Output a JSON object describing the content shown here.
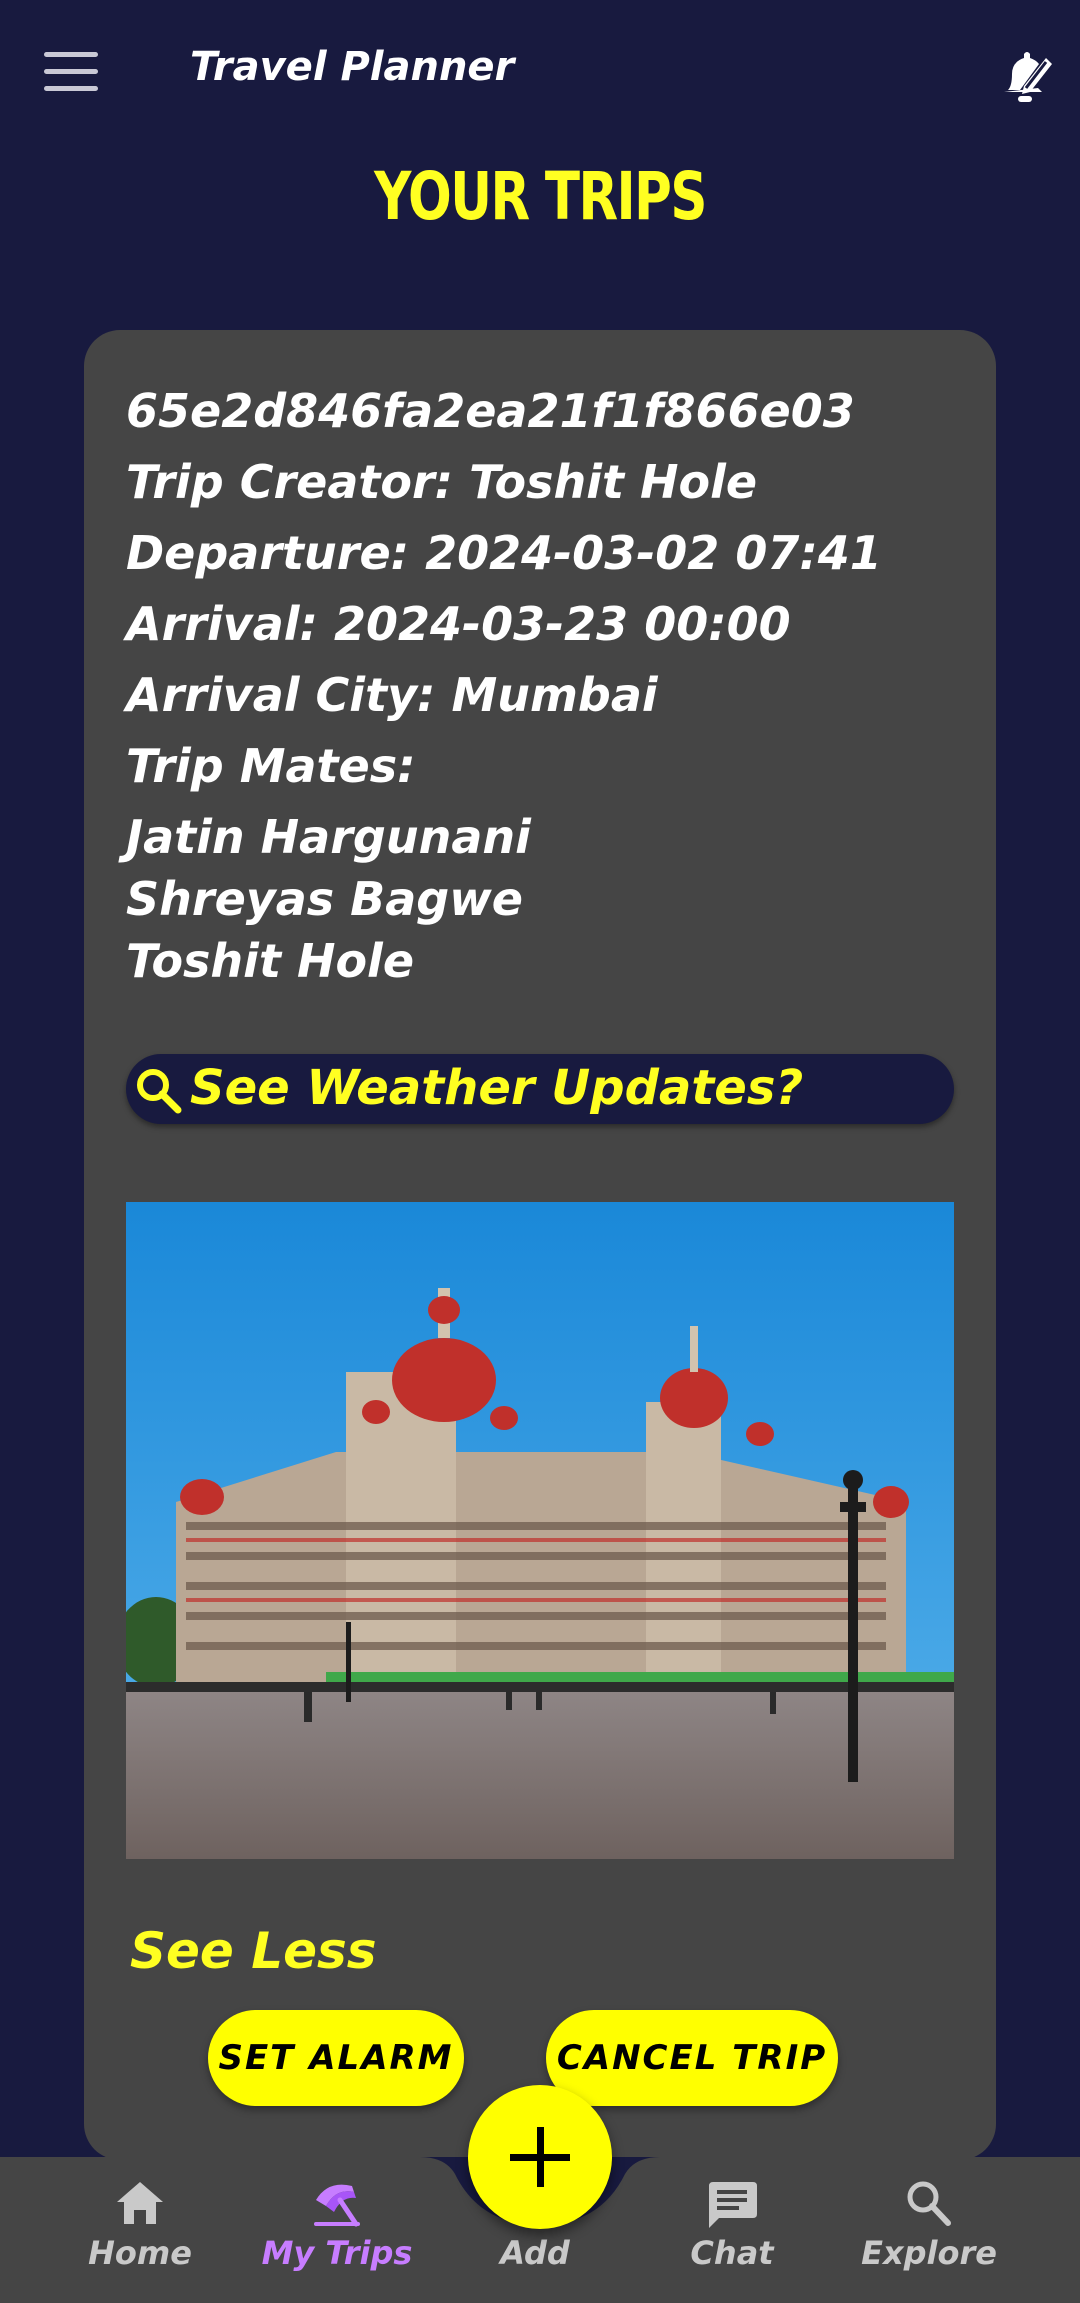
{
  "appbar": {
    "title": "Travel Planner",
    "menu_icon": "hamburger-menu-icon",
    "action_icon": "alarm-edit-icon"
  },
  "page": {
    "title": "YOUR TRIPS"
  },
  "trip": {
    "id": "65e2d846fa2ea21f1f866e03",
    "creator": "Trip Creator: Toshit Hole",
    "departure": "Departure: 2024-03-02 07:41",
    "arrival": "Arrival: 2024-03-23 00:00",
    "arrival_city": "Arrival City: Mumbai",
    "mates_label": "Trip Mates:",
    "mates": [
      "Jatin Hargunani",
      "Shreyas Bagwe",
      "Toshit Hole"
    ],
    "weather_button": "See Weather Updates?",
    "see_less": "See Less",
    "set_alarm": "SET ALARM",
    "cancel_trip": "CANCEL TRIP"
  },
  "bottom_nav": {
    "items": [
      {
        "label": "Home",
        "icon": "home-icon"
      },
      {
        "label": "My Trips",
        "icon": "beach-umbrella-icon",
        "active": true
      },
      {
        "label": "Add",
        "icon": "plus-icon"
      },
      {
        "label": "Chat",
        "icon": "chat-icon"
      },
      {
        "label": "Explore",
        "icon": "search-icon"
      }
    ]
  },
  "colors": {
    "background": "#181a3f",
    "card": "#454545",
    "accent": "#ffff21",
    "active": "#c77dff"
  }
}
